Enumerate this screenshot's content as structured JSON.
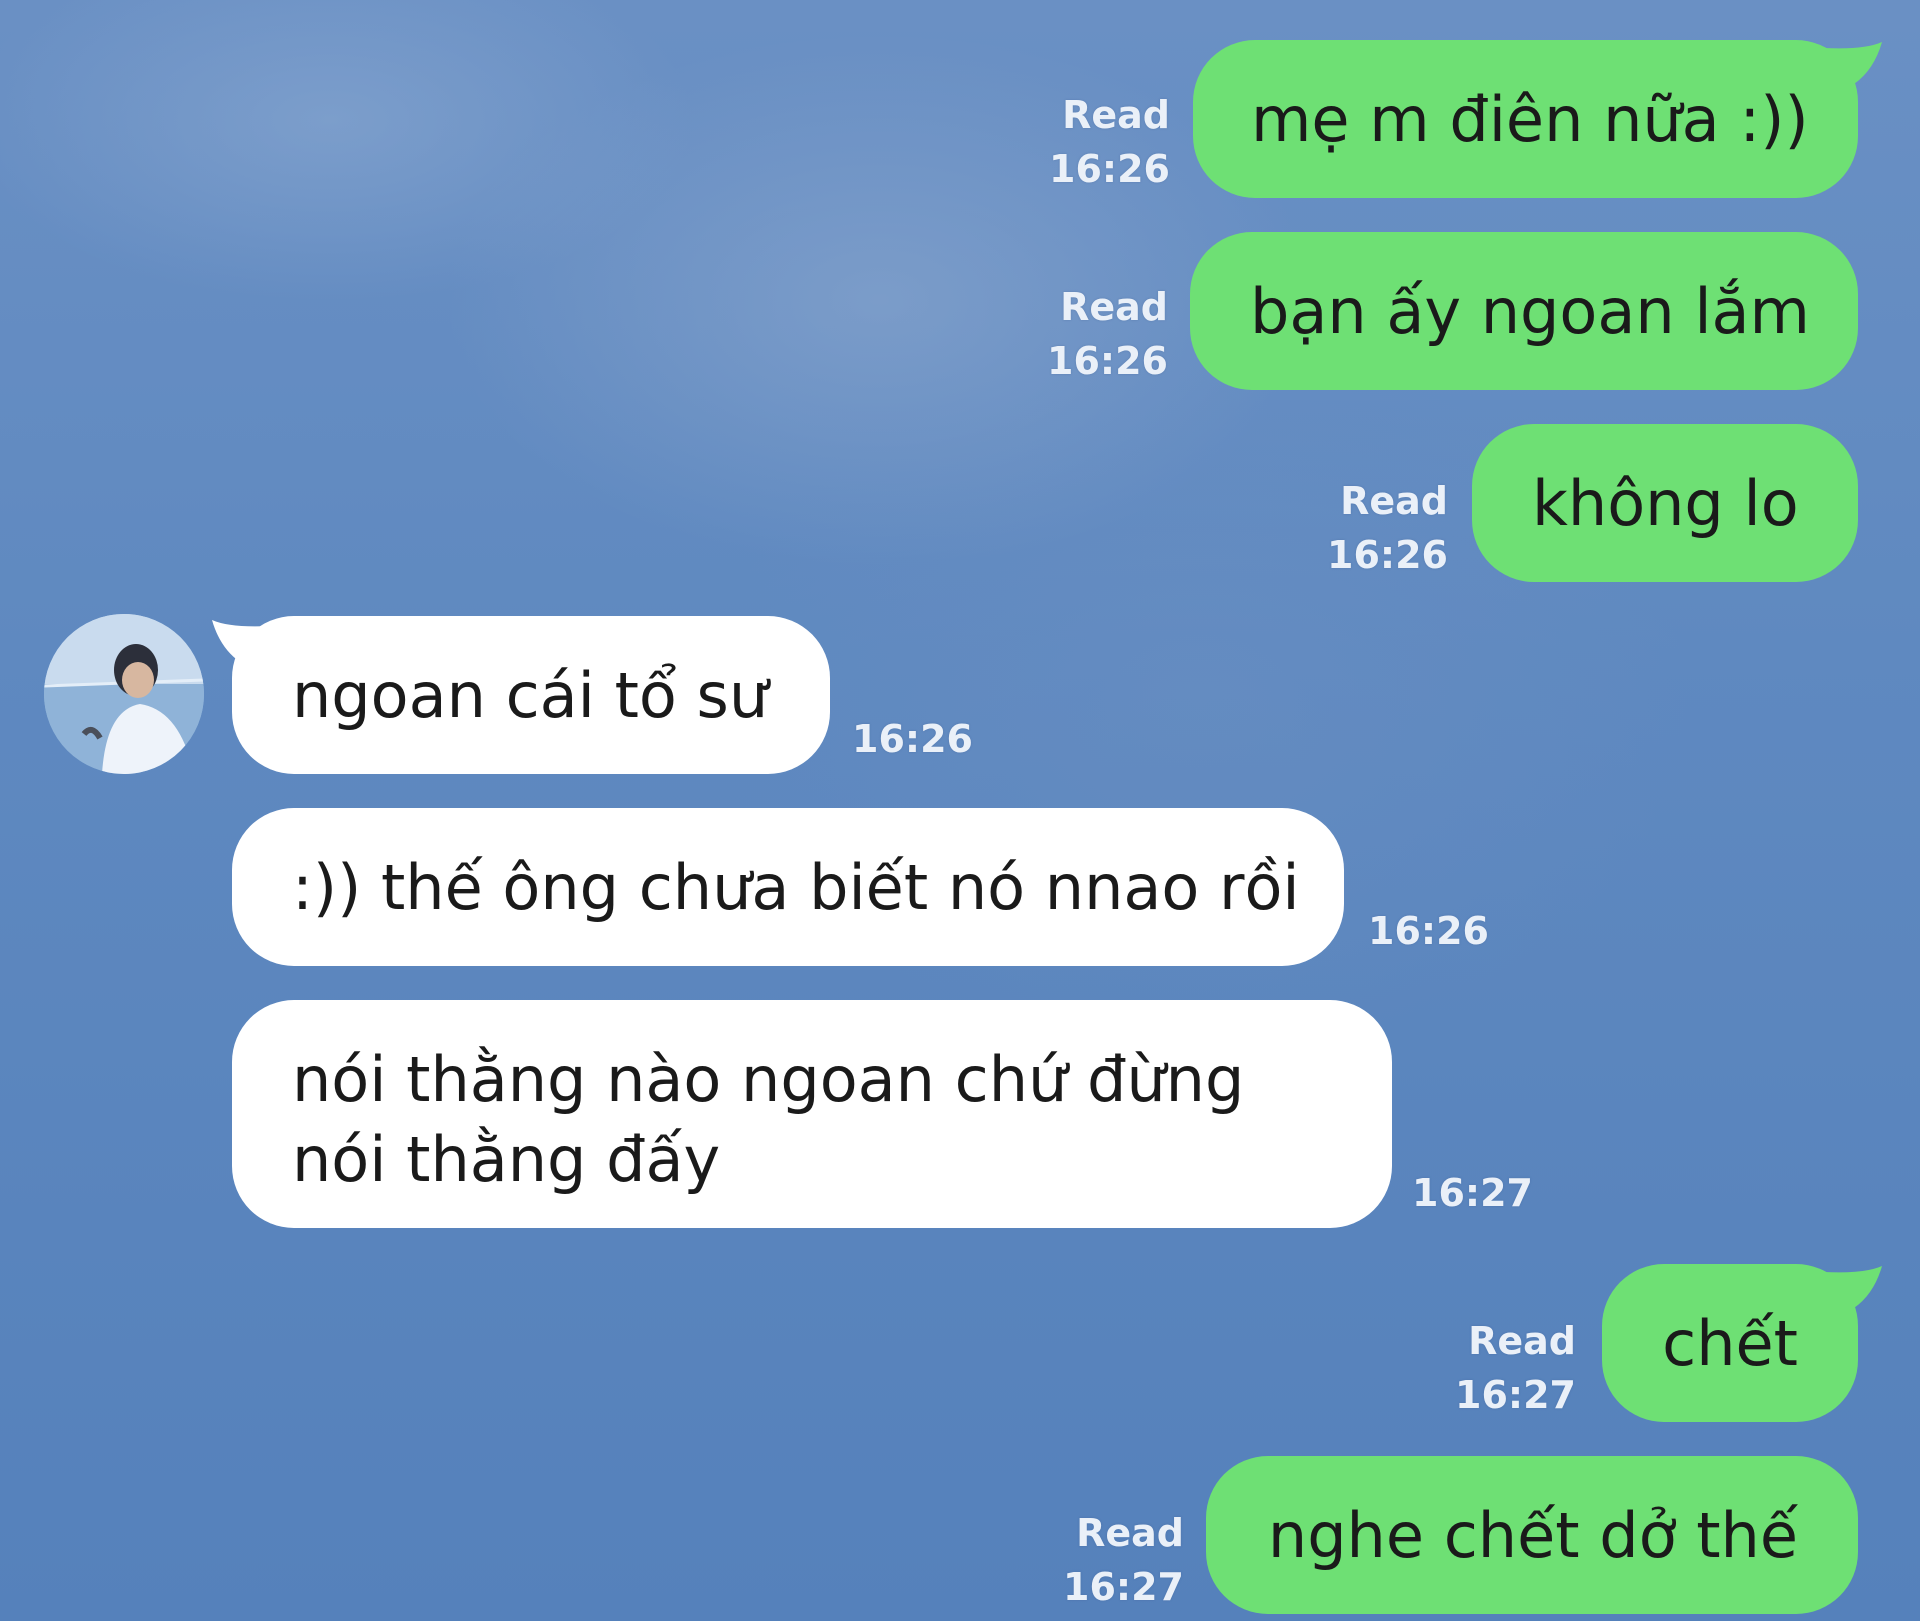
{
  "colors": {
    "background": "#5a86bd",
    "outgoing_bubble": "#6ee074",
    "incoming_bubble": "#ffffff",
    "meta_text": "#eaf0f8"
  },
  "messages": [
    {
      "direction": "out",
      "text": "mẹ m điên nữa :))",
      "status": "Read",
      "time": "16:26"
    },
    {
      "direction": "out",
      "text": "bạn ấy ngoan lắm",
      "status": "Read",
      "time": "16:26"
    },
    {
      "direction": "out",
      "text": "không lo",
      "status": "Read",
      "time": "16:26"
    },
    {
      "direction": "in",
      "text": "ngoan cái tổ sư",
      "time": "16:26"
    },
    {
      "direction": "in",
      "text": ":)) thế ông chưa biết nó nnao rồi",
      "time": "16:26"
    },
    {
      "direction": "in",
      "lines": [
        "nói thằng nào ngoan chứ đừng",
        "nói thằng đấy"
      ],
      "time": "16:27"
    },
    {
      "direction": "out",
      "text": "chết",
      "status": "Read",
      "time": "16:27"
    },
    {
      "direction": "out",
      "text": "nghe chết dở thế",
      "status": "Read",
      "time": "16:27"
    }
  ],
  "avatar": {
    "icon": "contact-avatar-photo"
  }
}
